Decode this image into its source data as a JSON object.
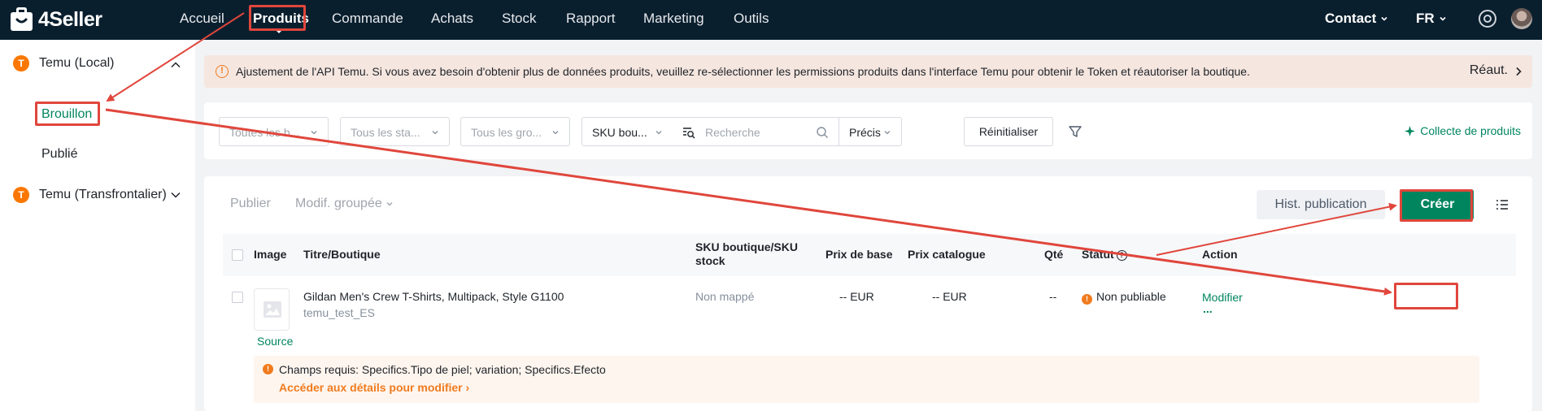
{
  "brand": {
    "name": "4Seller"
  },
  "nav": {
    "items": [
      {
        "label": "Accueil"
      },
      {
        "label": "Produits"
      },
      {
        "label": "Commande"
      },
      {
        "label": "Achats"
      },
      {
        "label": "Stock"
      },
      {
        "label": "Rapport"
      },
      {
        "label": "Marketing"
      },
      {
        "label": "Outils"
      }
    ],
    "active_index": 1,
    "contact": "Contact",
    "language": "FR"
  },
  "sidebar": {
    "groups": [
      {
        "badge": "T",
        "label": "Temu (Local)",
        "expanded": true,
        "items": [
          {
            "label": "Brouillon",
            "active": true
          },
          {
            "label": "Publié",
            "active": false
          }
        ]
      },
      {
        "badge": "T",
        "label": "Temu (Transfrontalier)",
        "expanded": false,
        "items": []
      }
    ]
  },
  "notice": {
    "text": "Ajustement de l'API Temu. Si vous avez besoin d'obtenir plus de données produits, veuillez re-sélectionner les permissions produits dans l'interface Temu pour obtenir le Token et réautoriser la boutique.",
    "link": "Réaut."
  },
  "filters": {
    "select1": "Toutes les b...",
    "select2": "Tous les sta...",
    "select3": "Tous les gro...",
    "sku_select": "SKU bou...",
    "search_placeholder": "Recherche",
    "match_select": "Précis",
    "reset": "Réinitialiser",
    "collect": "Collecte de produits"
  },
  "toolbar": {
    "publish": "Publier",
    "bulk_edit": "Modif. groupée",
    "history": "Hist. publication",
    "create": "Créer"
  },
  "table": {
    "headers": {
      "image": "Image",
      "title": "Titre/Boutique",
      "sku_line1": "SKU boutique/SKU",
      "sku_line2": "stock",
      "base_price": "Prix de base",
      "catalog_price": "Prix catalogue",
      "qty": "Qté",
      "status": "Statut",
      "action": "Action"
    },
    "rows": [
      {
        "title": "Gildan Men's Crew T-Shirts, Multipack, Style G1100",
        "shop": "temu_test_ES",
        "source": "Source",
        "sku": "Non mappé",
        "base_price": "-- EUR",
        "catalog_price": "-- EUR",
        "qty": "--",
        "status": "Non publiable",
        "action": "Modifier",
        "more": "...",
        "warning": "Champs requis: Specifics.Tipo de piel; variation; Specifics.Efecto",
        "warning_link": "Accéder aux détails pour modifier"
      }
    ]
  },
  "colors": {
    "topbar": "#0a1f2e",
    "accent": "#00855f",
    "temu_badge": "#fb7701",
    "annotation": "#e0463c",
    "warning": "#f07b1f"
  }
}
